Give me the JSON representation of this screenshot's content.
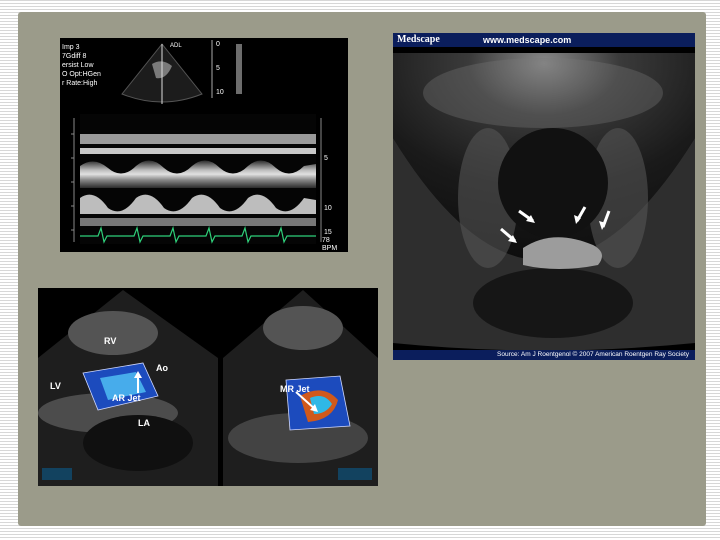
{
  "panels": {
    "mmode": {
      "settings_lines": [
        "Imp 3",
        "7Gdiff 8",
        "ersist Low",
        "O Opt:HGen",
        "r Rate:High"
      ],
      "depth_ticks": [
        "0",
        "5",
        "10"
      ],
      "right_scale": [
        "5",
        "10",
        "15"
      ],
      "bpm_value": "78",
      "bpm_unit": "BPM"
    },
    "medscape": {
      "brand": "Medscape",
      "url": "www.medscape.com",
      "source": "Source: Am J Roentgenol © 2007 American Roentgen Ray Society"
    },
    "doppler": {
      "labels": {
        "rv": "RV",
        "ao": "Ao",
        "lv": "LV",
        "ar_jet": "AR Jet",
        "la": "LA",
        "mr_jet": "MR Jet"
      }
    }
  }
}
